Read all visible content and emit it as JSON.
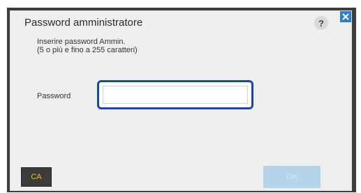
{
  "dialog": {
    "title": "Password amministratore",
    "help_label": "?",
    "instructions_line1": "Inserire password Ammin.",
    "instructions_line2": "(5 o più e fino a 255 caratteri)",
    "password_label": "Password",
    "password_value": "",
    "ca_label": "CA",
    "ok_label": "OK"
  },
  "colors": {
    "focus_border": "#1a4a95",
    "close_button": "#2e7fc7",
    "ca_text": "#f2c319",
    "ok_disabled": "#b4d4ea"
  },
  "icons": {
    "help": "help-icon",
    "close": "close-icon"
  }
}
